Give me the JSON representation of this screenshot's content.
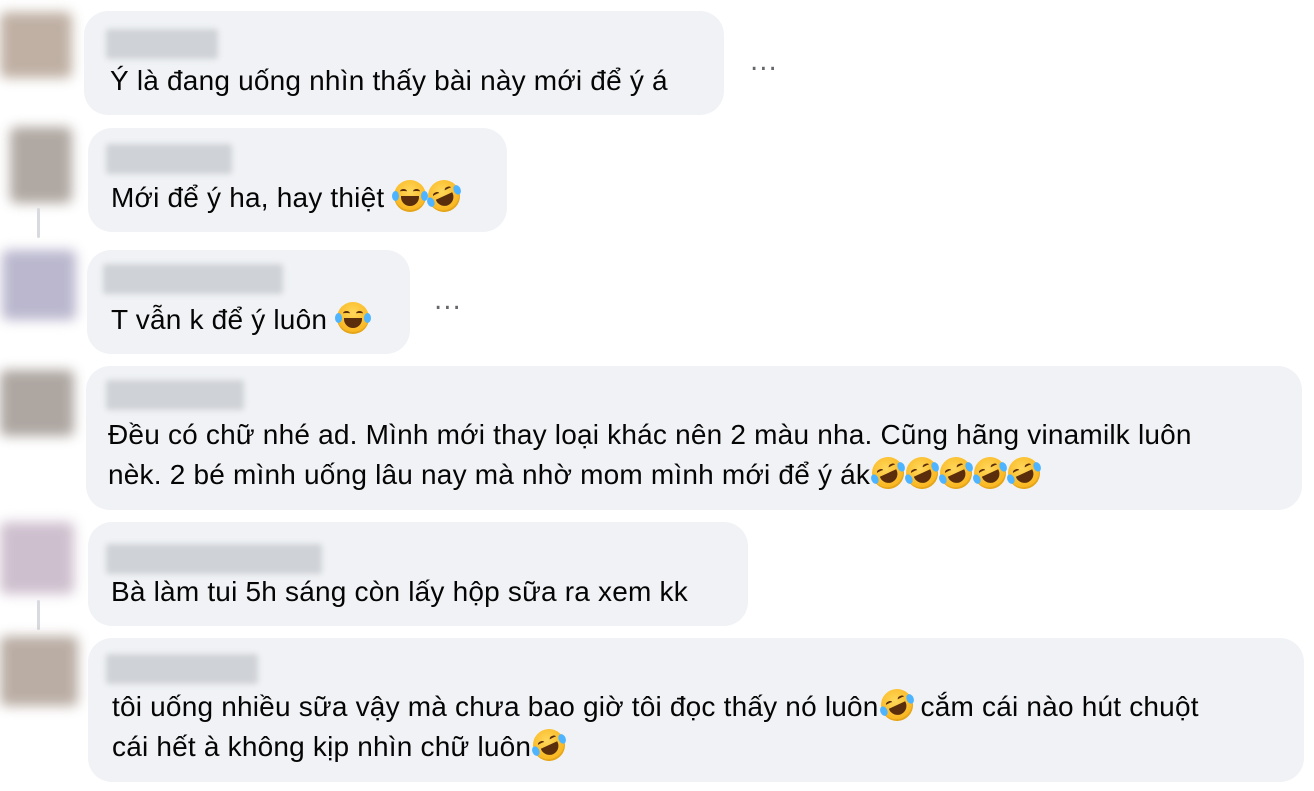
{
  "comments": [
    {
      "text": "Ý là đang uống nhìn thấy bài này mới để ý á",
      "emojis": [],
      "has_more_menu": true,
      "avatar_color": "#b9a89a"
    },
    {
      "text": "Mới để ý ha, hay thiệt",
      "emojis": [
        "face-with-tears-of-joy-icon",
        "rolling-on-floor-laughing-icon"
      ],
      "has_more_menu": false,
      "avatar_color": "#a89f98"
    },
    {
      "text": "T vẫn k để ý luôn",
      "emojis": [
        "face-with-tears-of-joy-icon"
      ],
      "has_more_menu": true,
      "avatar_color": "#b3b0c9"
    },
    {
      "line1": "Đều có chữ nhé ad. Mình mới thay loại khác nên 2 màu nha. Cũng hãng vinamilk luôn",
      "line2": "nèk. 2 bé mình uống lâu nay mà nhờ mom mình mới để ý ák",
      "emojis": [
        "rolling-on-floor-laughing-icon",
        "rolling-on-floor-laughing-icon",
        "rolling-on-floor-laughing-icon",
        "rolling-on-floor-laughing-icon",
        "rolling-on-floor-laughing-icon"
      ],
      "has_more_menu": false,
      "avatar_color": "#a59d97"
    },
    {
      "text": "Bà làm tui 5h sáng còn lấy hộp sữa ra xem kk",
      "emojis": [],
      "has_more_menu": false,
      "avatar_color": "#c9b9c9"
    },
    {
      "line1_a": "tôi uống nhiều sữa vậy mà chưa bao giờ tôi đọc thấy nó luôn",
      "line1_b": " cắm cái nào hút chuột",
      "line2": "cái hết à không kịp nhìn chữ luôn",
      "emojis": [
        "rolling-on-floor-laughing-icon",
        "rolling-on-floor-laughing-icon"
      ],
      "has_more_menu": false,
      "avatar_color": "#b3a59b"
    }
  ],
  "more_menu_label": "..."
}
